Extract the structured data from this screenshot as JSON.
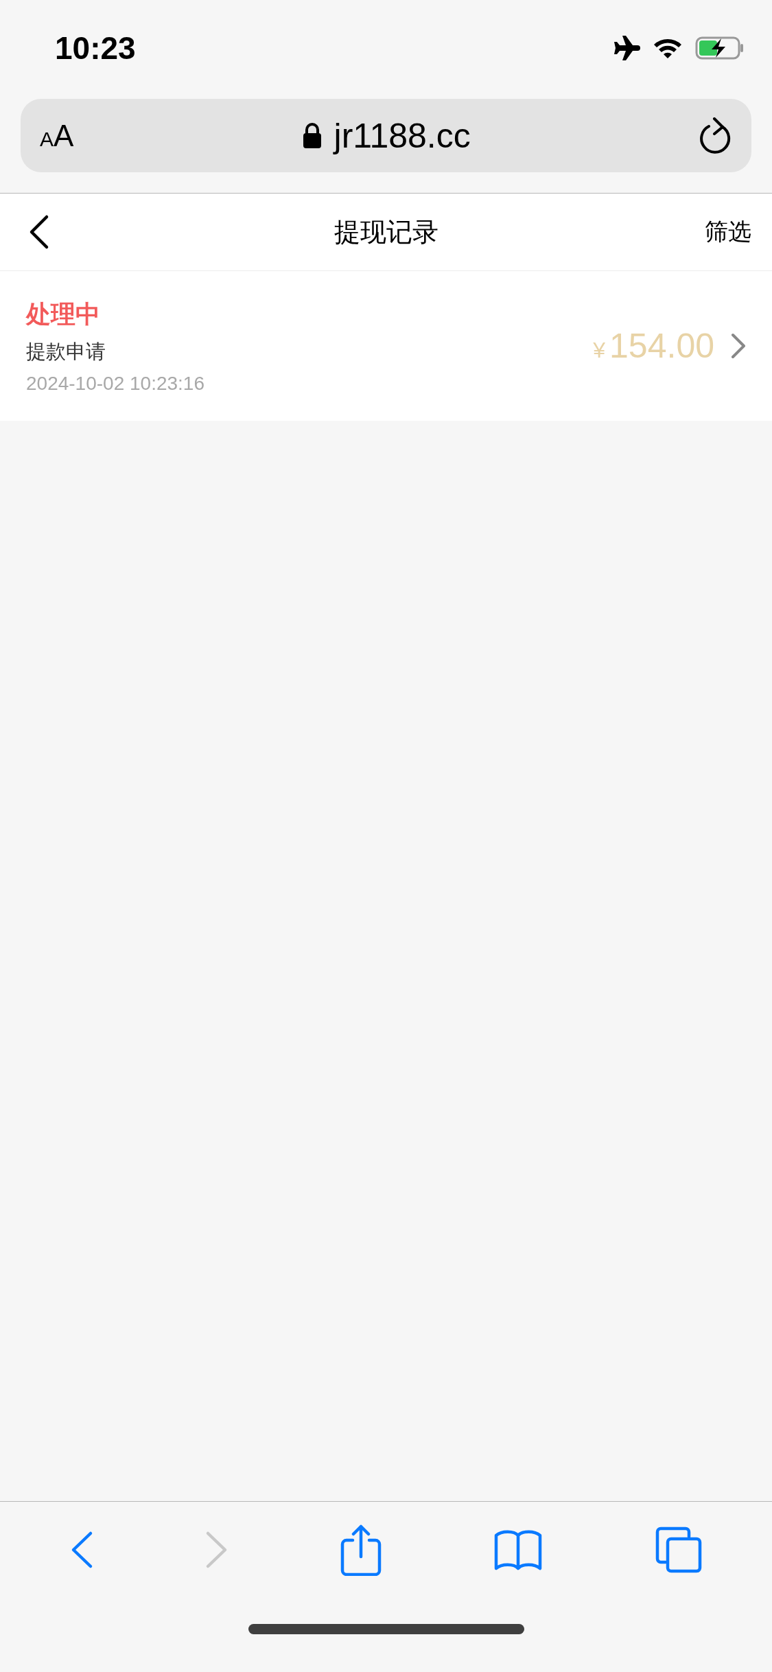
{
  "status_bar": {
    "time": "10:23"
  },
  "address_bar": {
    "text_size_label": "AA",
    "url": "jr1188.cc"
  },
  "header": {
    "title": "提现记录",
    "action": "筛选"
  },
  "records": [
    {
      "status": "处理中",
      "title": "提款申请",
      "time": "2024-10-02 10:23:16",
      "currency": "¥",
      "amount": "154.00"
    }
  ],
  "toolbar": [
    {
      "kind": "back",
      "disabled": false
    },
    {
      "kind": "forward",
      "disabled": true
    },
    {
      "kind": "share",
      "disabled": false
    },
    {
      "kind": "bookmarks",
      "disabled": false
    },
    {
      "kind": "tabs",
      "disabled": false
    }
  ]
}
